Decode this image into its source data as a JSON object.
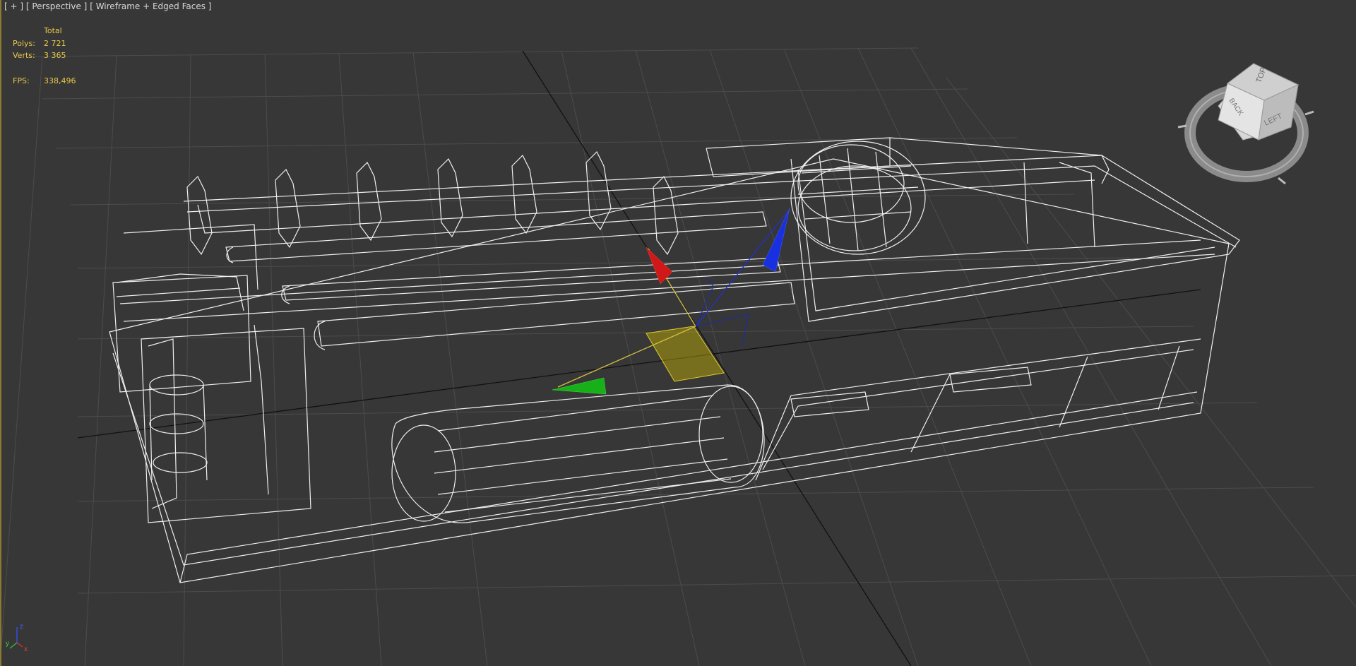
{
  "viewport": {
    "label_plus": "[ + ]",
    "label_view": "[ Perspective ]",
    "label_shading": "[ Wireframe + Edged Faces ]"
  },
  "stats": {
    "header": "Total",
    "polys_label": "Polys:",
    "polys_value": "2 721",
    "verts_label": "Verts:",
    "verts_value": "3 365",
    "fps_label": "FPS:",
    "fps_value": "338,496"
  },
  "viewcube": {
    "top_label": "TOP",
    "back_label": "BACK",
    "left_label": "LEFT"
  },
  "axis_tripod": {
    "x_label": "x",
    "y_label": "y",
    "z_label": "z"
  },
  "colors": {
    "background": "#373737",
    "grid": "#4a4a4a",
    "wire": "#ffffff",
    "stats_text": "#e8c84a",
    "gizmo_x": "#d01818",
    "gizmo_y": "#18b018",
    "gizmo_z": "#1830e0",
    "gizmo_plane": "#c8b400"
  }
}
